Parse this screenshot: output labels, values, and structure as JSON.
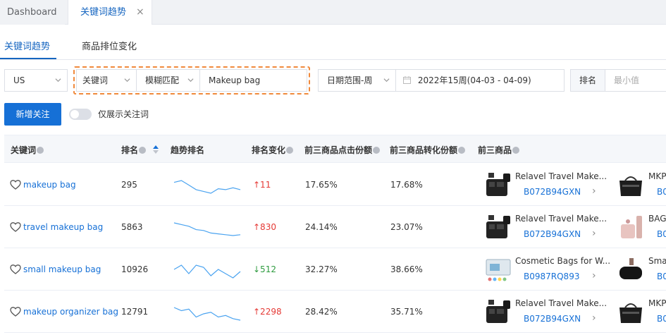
{
  "tabs": {
    "dashboard": "Dashboard",
    "active": "关键词趋势",
    "close": "×"
  },
  "subtabs": [
    "关键词趋势",
    "商品排位变化"
  ],
  "filters": {
    "marketplace": "US",
    "field": "关键词",
    "match": "模糊匹配",
    "keyword_value": "Makeup bag",
    "date_range": "日期范围-周",
    "date_value": "2022年15周(04-03 - 04-09)",
    "rank_label": "排名",
    "rank_min_placeholder": "最小值"
  },
  "actions": {
    "add_follow": "新增关注",
    "only_followed": "仅展示关注词",
    "only_followed_enabled": false
  },
  "table": {
    "headers": {
      "keyword": "关键词",
      "rank": "排名",
      "trend": "趋势排名",
      "rank_change": "排名变化",
      "click_share": "前三商品点击份额",
      "conv_share": "前三商品转化份额",
      "top_products": "前三商品"
    },
    "rows": [
      {
        "keyword": "makeup bag",
        "rank": "295",
        "change": "↑11",
        "direction": "up",
        "click_share": "17.65%",
        "conv_share": "17.68%",
        "trend_values": [
          48,
          50,
          45,
          40,
          38,
          36,
          41,
          40,
          42,
          40
        ],
        "product1": {
          "title": "Relavel Travel Make...",
          "asin": "B072B94GXN",
          "image": "black-cosmetic-case"
        },
        "product2": {
          "title": "MKP",
          "asin": "B0",
          "image": "black-cosmetic-bag"
        }
      },
      {
        "keyword": "travel makeup bag",
        "rank": "5863",
        "change": "↑830",
        "direction": "up",
        "click_share": "24.14%",
        "conv_share": "23.07%",
        "trend_values": [
          50,
          48,
          46,
          42,
          41,
          38,
          37,
          36,
          35,
          36
        ],
        "product1": {
          "title": "Relavel Travel Make...",
          "asin": "B072B94GXN",
          "image": "black-cosmetic-case"
        },
        "product2": {
          "title": "BAG",
          "asin": "B0",
          "image": "pink-toiletry-bag"
        }
      },
      {
        "keyword": "small makeup bag",
        "rank": "10926",
        "change": "↓512",
        "direction": "down",
        "click_share": "32.27%",
        "conv_share": "38.66%",
        "trend_values": [
          44,
          46,
          42,
          46,
          45,
          41,
          44,
          42,
          40,
          43
        ],
        "product1": {
          "title": "Cosmetic Bags for W...",
          "asin": "B0987RQ893",
          "image": "clear-cosmetic-bag"
        },
        "product2": {
          "title": "Sma",
          "asin": "B0",
          "image": "black-pouch"
        }
      },
      {
        "keyword": "makeup organizer bag",
        "rank": "12791",
        "change": "↑2298",
        "direction": "up",
        "click_share": "28.42%",
        "conv_share": "35.71%",
        "trend_values": [
          48,
          46,
          47,
          42,
          44,
          45,
          42,
          43,
          41,
          40
        ],
        "product1": {
          "title": "Relavel Travel Make...",
          "asin": "B072B94GXN",
          "image": "black-cosmetic-case"
        },
        "product2": {
          "title": "MKP",
          "asin": "B0",
          "image": "black-cosmetic-bag"
        }
      }
    ]
  },
  "colors": {
    "accent": "#1670d6",
    "up": "#e53935",
    "down": "#2e9b3f",
    "highlight_border": "#f08a3c",
    "sparkline": "#4aa3f0"
  }
}
